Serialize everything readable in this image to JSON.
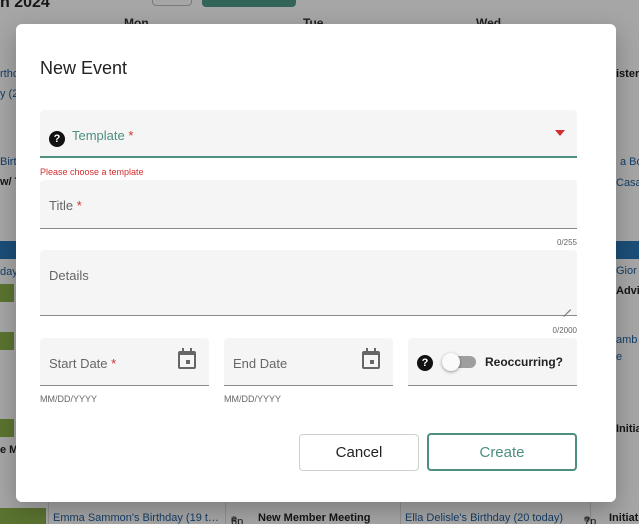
{
  "background": {
    "header_title": "h 2024",
    "days": [
      "Mon",
      "Tue",
      "Wed"
    ],
    "left_fragments": [
      "rthday",
      "y (20",
      "Birth",
      "w/ T",
      "day (",
      "e M"
    ],
    "right_fragments": [
      "isterh",
      "a Boe",
      "Casa",
      "Gior",
      "Advisc",
      "amb",
      "e",
      "Initiati"
    ],
    "bottom_row": {
      "mon_event": "Emma Sammon's Birthday (19 t…",
      "tue_time": "6p",
      "tue_event": "New Member Meeting",
      "wed_event": "Ella Delisle's Birthday (20 today)",
      "thu_time": "7p",
      "thu_event": "Initiati"
    }
  },
  "dialog": {
    "title": "New Event",
    "template": {
      "label": "Template",
      "required_mark": "*",
      "error": "Please choose a template",
      "help_icon": "question-circle-icon",
      "dropdown_icon": "caret-down-icon"
    },
    "title_field": {
      "label": "Title",
      "required_mark": "*",
      "counter": "0/255"
    },
    "details_field": {
      "label": "Details",
      "counter": "0/2000"
    },
    "start_date": {
      "label": "Start Date",
      "required_mark": "*",
      "hint": "MM/DD/YYYY",
      "icon": "calendar-icon"
    },
    "end_date": {
      "label": "End Date",
      "hint": "MM/DD/YYYY",
      "icon": "calendar-icon"
    },
    "reoccurring": {
      "label": "Reoccurring?",
      "enabled": false,
      "help_icon": "question-circle-icon"
    },
    "buttons": {
      "cancel": "Cancel",
      "create": "Create"
    }
  },
  "colors": {
    "accent": "#4d8f80",
    "error": "#d32f2f",
    "field_bg": "#f5f5f5"
  }
}
